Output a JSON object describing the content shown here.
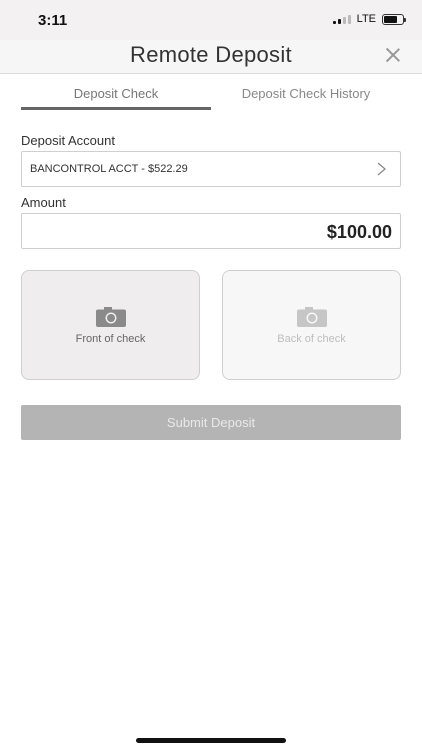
{
  "status": {
    "time": "3:11",
    "network": "LTE"
  },
  "header": {
    "title": "Remote Deposit"
  },
  "tabs": [
    {
      "label": "Deposit Check"
    },
    {
      "label": "Deposit Check History"
    }
  ],
  "form": {
    "account_label": "Deposit Account",
    "account_value": "BANCONTROL ACCT - $522.29",
    "amount_label": "Amount",
    "amount_value": "$100.00"
  },
  "check": {
    "front_label": "Front of check",
    "back_label": "Back of check"
  },
  "submit": {
    "label": "Submit Deposit"
  },
  "colors": {
    "button_disabled": "#b4b4b4",
    "tab_underline": "#666666"
  }
}
